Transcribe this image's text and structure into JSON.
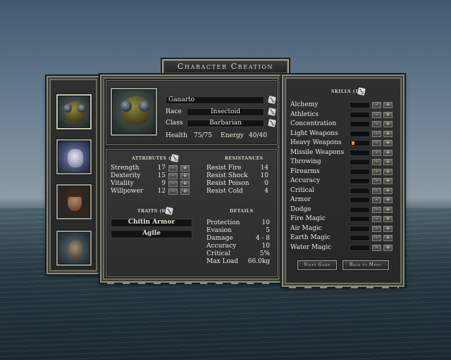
{
  "window": {
    "title": "Character Creation"
  },
  "portraits": [
    {
      "name": "insectoid-portrait",
      "selected": true
    },
    {
      "name": "horned-creature-portrait",
      "selected": false
    },
    {
      "name": "human-woman-portrait",
      "selected": false
    },
    {
      "name": "lizard-warrior-portrait",
      "selected": false
    }
  ],
  "character": {
    "name": "Ganarto",
    "race_label": "Race",
    "race": "Insectoid",
    "class_label": "Class",
    "class": "Barbarian",
    "health_label": "Health",
    "health": "75/75",
    "energy_label": "Energy",
    "energy": "40/40"
  },
  "attributes": {
    "header": "ATTRIBUTES (0)",
    "items": [
      {
        "label": "Strength",
        "value": "17"
      },
      {
        "label": "Dexterity",
        "value": "15"
      },
      {
        "label": "Vitality",
        "value": "9"
      },
      {
        "label": "Willpower",
        "value": "12"
      }
    ]
  },
  "resistances": {
    "header": "RESISTANCES",
    "items": [
      {
        "label": "Resist Fire",
        "value": "14"
      },
      {
        "label": "Resist Shock",
        "value": "10"
      },
      {
        "label": "Resist Poison",
        "value": "0"
      },
      {
        "label": "Resist Cold",
        "value": "4"
      }
    ]
  },
  "traits": {
    "header": "TRAITS (0)",
    "items": [
      "Chitin Armor",
      "Agile"
    ]
  },
  "details": {
    "header": "DETAILS",
    "items": [
      {
        "label": "Protection",
        "value": "10"
      },
      {
        "label": "Evasion",
        "value": "5"
      },
      {
        "label": "Damage",
        "value": "4 - 8"
      },
      {
        "label": "Accuracy",
        "value": "10"
      },
      {
        "label": "Critical",
        "value": "5%"
      },
      {
        "label": "Max Load",
        "value": "66.0kg"
      }
    ]
  },
  "skills": {
    "header": "SKILLS (1)",
    "items": [
      {
        "label": "Alchemy",
        "level": 0
      },
      {
        "label": "Athletics",
        "level": 0
      },
      {
        "label": "Concentration",
        "level": 0
      },
      {
        "label": "Light Weapons",
        "level": 0
      },
      {
        "label": "Heavy Weapons",
        "level": 1
      },
      {
        "label": "Missile Weapons",
        "level": 0
      },
      {
        "label": "Throwing",
        "level": 0
      },
      {
        "label": "Firearms",
        "level": 0
      },
      {
        "label": "Accuracy",
        "level": 0
      },
      {
        "label": "Critical",
        "level": 0
      },
      {
        "label": "Armor",
        "level": 0
      },
      {
        "label": "Dodge",
        "level": 0
      },
      {
        "label": "Fire Magic",
        "level": 0
      },
      {
        "label": "Air Magic",
        "level": 0
      },
      {
        "label": "Earth Magic",
        "level": 0
      },
      {
        "label": "Water Magic",
        "level": 0
      }
    ],
    "minus": "-",
    "plus": "+"
  },
  "buttons": {
    "start": "Start Game",
    "back": "Back to Menu"
  },
  "colors": {
    "panel": "#2e2f2f",
    "border": "#8a8a82",
    "skill_point": "#d59a2a"
  }
}
